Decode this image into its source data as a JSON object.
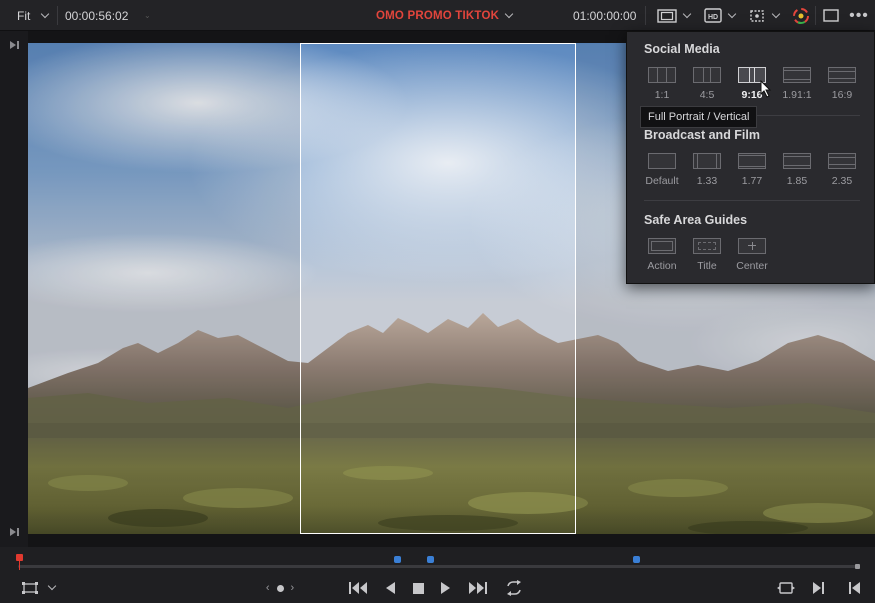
{
  "toolbar": {
    "zoom_label": "Fit",
    "source_timecode": "00:00:56:02",
    "timeline_title": "OMO PROMO TIKTOK",
    "record_timecode": "01:00:00:00"
  },
  "viewer_settings_panel": {
    "social_media": {
      "title": "Social Media",
      "options": [
        {
          "label": "1:1",
          "selected": false
        },
        {
          "label": "4:5",
          "selected": false
        },
        {
          "label": "9:16",
          "selected": true
        },
        {
          "label": "1.91:1",
          "selected": false
        },
        {
          "label": "16:9",
          "selected": false
        }
      ]
    },
    "tooltip": "Full Portrait / Vertical",
    "broadcast": {
      "title": "Broadcast and Film",
      "options": [
        {
          "label": "Default"
        },
        {
          "label": "1.33"
        },
        {
          "label": "1.77"
        },
        {
          "label": "1.85"
        },
        {
          "label": "2.35"
        }
      ]
    },
    "safe_area": {
      "title": "Safe Area Guides",
      "options": [
        {
          "label": "Action"
        },
        {
          "label": "Title"
        },
        {
          "label": "Center"
        }
      ]
    }
  },
  "colors": {
    "title_accent": "#e2453c",
    "marker": "#3a7fd6",
    "playhead": "#e0392f",
    "crop_frame": "#ffffff"
  },
  "icons": {
    "viewer_mode": "safe-area-icon",
    "hd_output": "hd-output-icon",
    "transform": "transform-icon",
    "color_wheel": "color-icon",
    "fullscreen": "viewer-window-icon",
    "more": "ellipsis-icon"
  }
}
